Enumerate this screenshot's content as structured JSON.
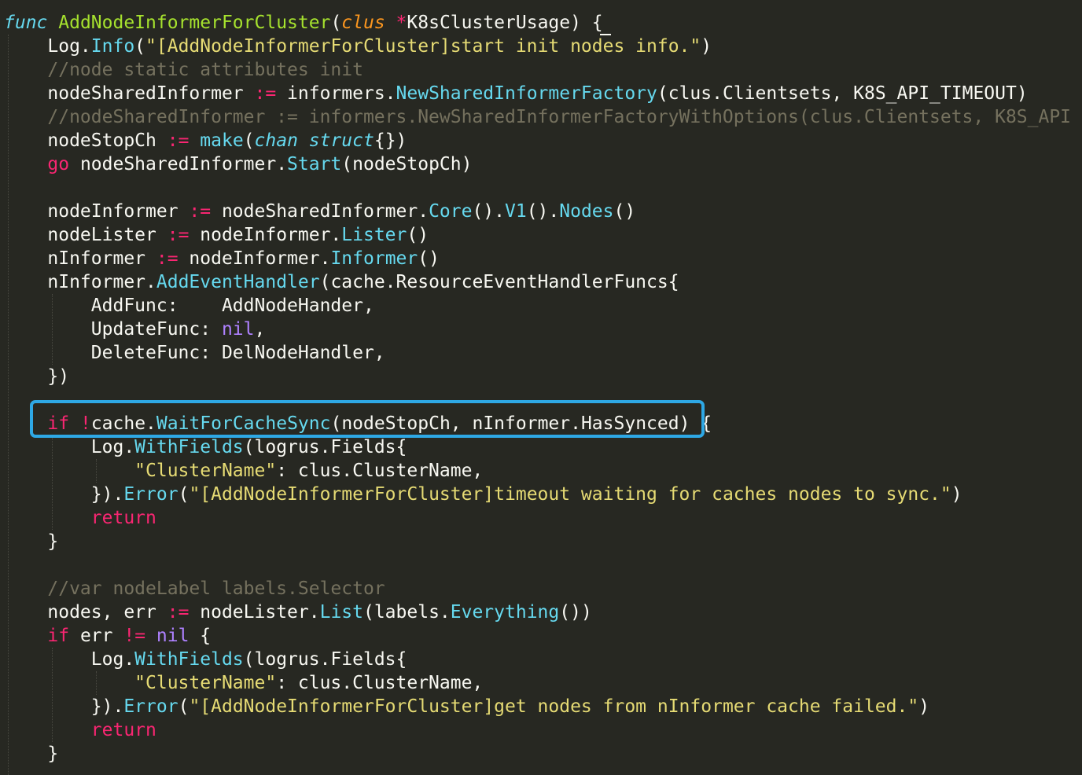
{
  "editor": {
    "language": "Go",
    "theme": "Monokai",
    "highlight_color": "#2ea8e5",
    "lines": [
      [
        {
          "t": "func",
          "c": "kw-italic"
        },
        {
          "t": " ",
          "c": "plain"
        },
        {
          "t": "AddNodeInformerForCluster",
          "c": "fn"
        },
        {
          "t": "(",
          "c": "plain"
        },
        {
          "t": "clus",
          "c": "param"
        },
        {
          "t": " ",
          "c": "plain"
        },
        {
          "t": "*",
          "c": "op"
        },
        {
          "t": "K8sClusterUsage) {",
          "c": "plain"
        }
      ],
      [
        {
          "t": "    Log.",
          "c": "plain"
        },
        {
          "t": "Info",
          "c": "method"
        },
        {
          "t": "(",
          "c": "plain"
        },
        {
          "t": "\"[AddNodeInformerForCluster]start init nodes info.\"",
          "c": "str"
        },
        {
          "t": ")",
          "c": "plain"
        }
      ],
      [
        {
          "t": "    //node static attributes init",
          "c": "comment"
        }
      ],
      [
        {
          "t": "    nodeSharedInformer ",
          "c": "plain"
        },
        {
          "t": ":=",
          "c": "op"
        },
        {
          "t": " informers.",
          "c": "plain"
        },
        {
          "t": "NewSharedInformerFactory",
          "c": "method"
        },
        {
          "t": "(clus.Clientsets, K8S_API_TIMEOUT)",
          "c": "plain"
        }
      ],
      [
        {
          "t": "    //nodeSharedInformer := informers.NewSharedInformerFactoryWithOptions(clus.Clientsets, K8S_API",
          "c": "comment"
        }
      ],
      [
        {
          "t": "    nodeStopCh ",
          "c": "plain"
        },
        {
          "t": ":=",
          "c": "op"
        },
        {
          "t": " ",
          "c": "plain"
        },
        {
          "t": "make",
          "c": "method"
        },
        {
          "t": "(",
          "c": "plain"
        },
        {
          "t": "chan struct",
          "c": "kw-italic"
        },
        {
          "t": "{})",
          "c": "plain"
        }
      ],
      [
        {
          "t": "    ",
          "c": "plain"
        },
        {
          "t": "go",
          "c": "kw"
        },
        {
          "t": " nodeSharedInformer.",
          "c": "plain"
        },
        {
          "t": "Start",
          "c": "method"
        },
        {
          "t": "(nodeStopCh)",
          "c": "plain"
        }
      ],
      [],
      [
        {
          "t": "    nodeInformer ",
          "c": "plain"
        },
        {
          "t": ":=",
          "c": "op"
        },
        {
          "t": " nodeSharedInformer.",
          "c": "plain"
        },
        {
          "t": "Core",
          "c": "method"
        },
        {
          "t": "().",
          "c": "plain"
        },
        {
          "t": "V1",
          "c": "method"
        },
        {
          "t": "().",
          "c": "plain"
        },
        {
          "t": "Nodes",
          "c": "method"
        },
        {
          "t": "()",
          "c": "plain"
        }
      ],
      [
        {
          "t": "    nodeLister ",
          "c": "plain"
        },
        {
          "t": ":=",
          "c": "op"
        },
        {
          "t": " nodeInformer.",
          "c": "plain"
        },
        {
          "t": "Lister",
          "c": "method"
        },
        {
          "t": "()",
          "c": "plain"
        }
      ],
      [
        {
          "t": "    nInformer ",
          "c": "plain"
        },
        {
          "t": ":=",
          "c": "op"
        },
        {
          "t": " nodeInformer.",
          "c": "plain"
        },
        {
          "t": "Informer",
          "c": "method"
        },
        {
          "t": "()",
          "c": "plain"
        }
      ],
      [
        {
          "t": "    nInformer.",
          "c": "plain"
        },
        {
          "t": "AddEventHandler",
          "c": "method"
        },
        {
          "t": "(cache.ResourceEventHandlerFuncs{",
          "c": "plain"
        }
      ],
      [
        {
          "t": "        AddFunc:    AddNodeHander,",
          "c": "plain"
        }
      ],
      [
        {
          "t": "        UpdateFunc: ",
          "c": "plain"
        },
        {
          "t": "nil",
          "c": "const"
        },
        {
          "t": ",",
          "c": "plain"
        }
      ],
      [
        {
          "t": "        DeleteFunc: DelNodeHandler,",
          "c": "plain"
        }
      ],
      [
        {
          "t": "    })",
          "c": "plain"
        }
      ],
      [],
      [
        {
          "t": "    ",
          "c": "plain"
        },
        {
          "t": "if",
          "c": "kw"
        },
        {
          "t": " ",
          "c": "plain"
        },
        {
          "t": "!",
          "c": "op"
        },
        {
          "t": "cache.",
          "c": "plain"
        },
        {
          "t": "WaitForCacheSync",
          "c": "method"
        },
        {
          "t": "(nodeStopCh, nInformer.HasSynced) {",
          "c": "plain"
        }
      ],
      [
        {
          "t": "        Log.",
          "c": "plain"
        },
        {
          "t": "WithFields",
          "c": "method"
        },
        {
          "t": "(logrus.Fields{",
          "c": "plain"
        }
      ],
      [
        {
          "t": "            ",
          "c": "plain"
        },
        {
          "t": "\"ClusterName\"",
          "c": "str"
        },
        {
          "t": ": clus.ClusterName,",
          "c": "plain"
        }
      ],
      [
        {
          "t": "        }).",
          "c": "plain"
        },
        {
          "t": "Error",
          "c": "method"
        },
        {
          "t": "(",
          "c": "plain"
        },
        {
          "t": "\"[AddNodeInformerForCluster]timeout waiting for caches nodes to sync.\"",
          "c": "str"
        },
        {
          "t": ")",
          "c": "plain"
        }
      ],
      [
        {
          "t": "        ",
          "c": "plain"
        },
        {
          "t": "return",
          "c": "kw"
        }
      ],
      [
        {
          "t": "    }",
          "c": "plain"
        }
      ],
      [],
      [
        {
          "t": "    //var nodeLabel labels.Selector",
          "c": "comment"
        }
      ],
      [
        {
          "t": "    nodes, err ",
          "c": "plain"
        },
        {
          "t": ":=",
          "c": "op"
        },
        {
          "t": " nodeLister.",
          "c": "plain"
        },
        {
          "t": "List",
          "c": "method"
        },
        {
          "t": "(labels.",
          "c": "plain"
        },
        {
          "t": "Everything",
          "c": "method"
        },
        {
          "t": "())",
          "c": "plain"
        }
      ],
      [
        {
          "t": "    ",
          "c": "plain"
        },
        {
          "t": "if",
          "c": "kw"
        },
        {
          "t": " err ",
          "c": "plain"
        },
        {
          "t": "!=",
          "c": "op"
        },
        {
          "t": " ",
          "c": "plain"
        },
        {
          "t": "nil",
          "c": "const"
        },
        {
          "t": " {",
          "c": "plain"
        }
      ],
      [
        {
          "t": "        Log.",
          "c": "plain"
        },
        {
          "t": "WithFields",
          "c": "method"
        },
        {
          "t": "(logrus.Fields{",
          "c": "plain"
        }
      ],
      [
        {
          "t": "            ",
          "c": "plain"
        },
        {
          "t": "\"ClusterName\"",
          "c": "str"
        },
        {
          "t": ": clus.ClusterName,",
          "c": "plain"
        }
      ],
      [
        {
          "t": "        }).",
          "c": "plain"
        },
        {
          "t": "Error",
          "c": "method"
        },
        {
          "t": "(",
          "c": "plain"
        },
        {
          "t": "\"[AddNodeInformerForCluster]get nodes from nInformer cache failed.\"",
          "c": "str"
        },
        {
          "t": ")",
          "c": "plain"
        }
      ],
      [
        {
          "t": "        ",
          "c": "plain"
        },
        {
          "t": "return",
          "c": "kw"
        }
      ],
      [
        {
          "t": "    }",
          "c": "plain"
        }
      ]
    ]
  }
}
